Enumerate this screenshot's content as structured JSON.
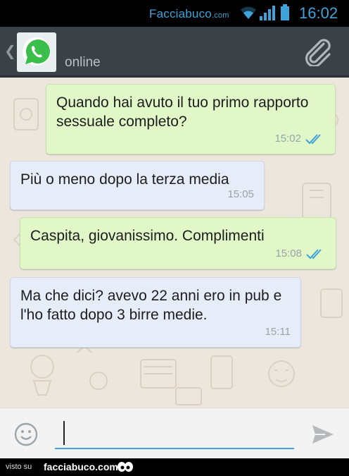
{
  "status_bar": {
    "brand_main": "Facciabuco",
    "brand_suffix": ".com",
    "time": "16:02",
    "icons": [
      "wifi-icon",
      "signal-icon",
      "battery-icon"
    ],
    "color": "#3ea3d8"
  },
  "header": {
    "back_icon": "chevron-left-icon",
    "avatar_icon": "whatsapp-logo-icon",
    "status": "online",
    "attach_icon": "paperclip-icon"
  },
  "messages": [
    {
      "direction": "out",
      "text": "Quando hai avuto il tuo primo rapporto sessuale completo?",
      "time": "15:02",
      "ticks": "read-double-check"
    },
    {
      "direction": "in",
      "text": "Più o meno dopo la terza media",
      "time": "15:05"
    },
    {
      "direction": "out",
      "text": "Caspita, giovanissimo. Complimenti",
      "time": "15:08",
      "ticks": "read-double-check"
    },
    {
      "direction": "in",
      "text": "Ma che dici? avevo 22 anni ero in pub e l'ho fatto dopo 3 birre medie.",
      "time": "15:11"
    }
  ],
  "input_bar": {
    "emoji_icon": "emoji-smiley-icon",
    "value": "",
    "send_icon": "send-icon"
  },
  "footer": {
    "visto": "visto su",
    "site": "facciabuco.com",
    "mascot_icon": "eyes-icon"
  },
  "colors": {
    "outgoing_bubble": "#e1f7c8",
    "incoming_bubble": "#e6ecf8",
    "chat_background": "#ece6dc",
    "header": "#3a4247",
    "read_tick": "#3ea3d8"
  }
}
